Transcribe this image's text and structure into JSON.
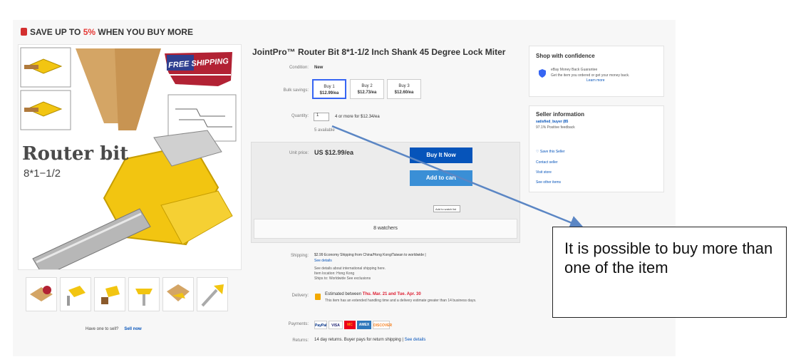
{
  "banner": {
    "prefix": "SAVE UP TO ",
    "percent": "5%",
    "suffix": " WHEN YOU BUY MORE"
  },
  "hero": {
    "title": "Router bit",
    "size": "8*1−1/2",
    "shipping_badge": "FREE SHIPPING"
  },
  "listing": {
    "title": "JointPro™ Router Bit 8*1-1/2 Inch Shank 45 Degree Lock Miter",
    "condition_label": "Condition:",
    "condition_value": "New",
    "bulk_label": "Bulk savings:",
    "bulk": [
      {
        "top": "Buy 1",
        "price": "$12.99/ea"
      },
      {
        "top": "Buy 2",
        "price": "$12.73/ea"
      },
      {
        "top": "Buy 3",
        "price": "$12.60/ea"
      }
    ],
    "quantity_label": "Quantity:",
    "quantity_value": "1",
    "quantity_note": "4 or more for $12.34/ea",
    "available": "5 available",
    "price_label": "Unit price:",
    "price_value": "US $12.99/ea",
    "buy_now": "Buy It Now",
    "add_to_cart": "Add to cart",
    "add_to_list": "Add to watch list",
    "watchers": "8 watchers",
    "shipping_label": "Shipping:",
    "shipping_main": "$2.99  Economy Shipping from China/Hong Kong/Taiwan to worldwide |",
    "shipping_details": "See details",
    "shipping_line2": "See details about international shipping here.",
    "shipping_line3": "Item location: Hong Kong",
    "shipping_line4": "Ships to: Worldwide  See exclusions",
    "delivery_label": "Delivery:",
    "delivery_prefix": "Estimated between ",
    "delivery_dates": "Thu. Mar. 21 and Tue. Apr. 30",
    "delivery_line2": "This item has an extended handling time and a delivery estimate greater than 14 business days.",
    "payments_label": "Payments:",
    "payments": [
      "PayPal",
      "VISA",
      "MC",
      "AMEX",
      "DISCOVER"
    ],
    "returns_label": "Returns:",
    "returns_value": "14 day returns. Buyer pays for return shipping |",
    "returns_link": "See details"
  },
  "sell": {
    "text": "Have one to sell?",
    "button": "Sell now"
  },
  "confidence": {
    "title": "Shop with confidence",
    "guarantee": "eBay Money Back Guarantee",
    "desc": "Get the item you ordered or get your money back.",
    "learn": "Learn more"
  },
  "seller": {
    "title": "Seller information",
    "name": "satisfied_buyer (85",
    "feedback": "97.1% Positive feedback",
    "save": "Save this Seller",
    "contact": "Contact seller",
    "store": "Visit store",
    "other": "See other items"
  },
  "callout": {
    "text": "It is possible to buy more than one of the item"
  },
  "colors": {
    "accent": "#0654ba",
    "arrow": "#5b86c4",
    "sale": "#e53935"
  }
}
